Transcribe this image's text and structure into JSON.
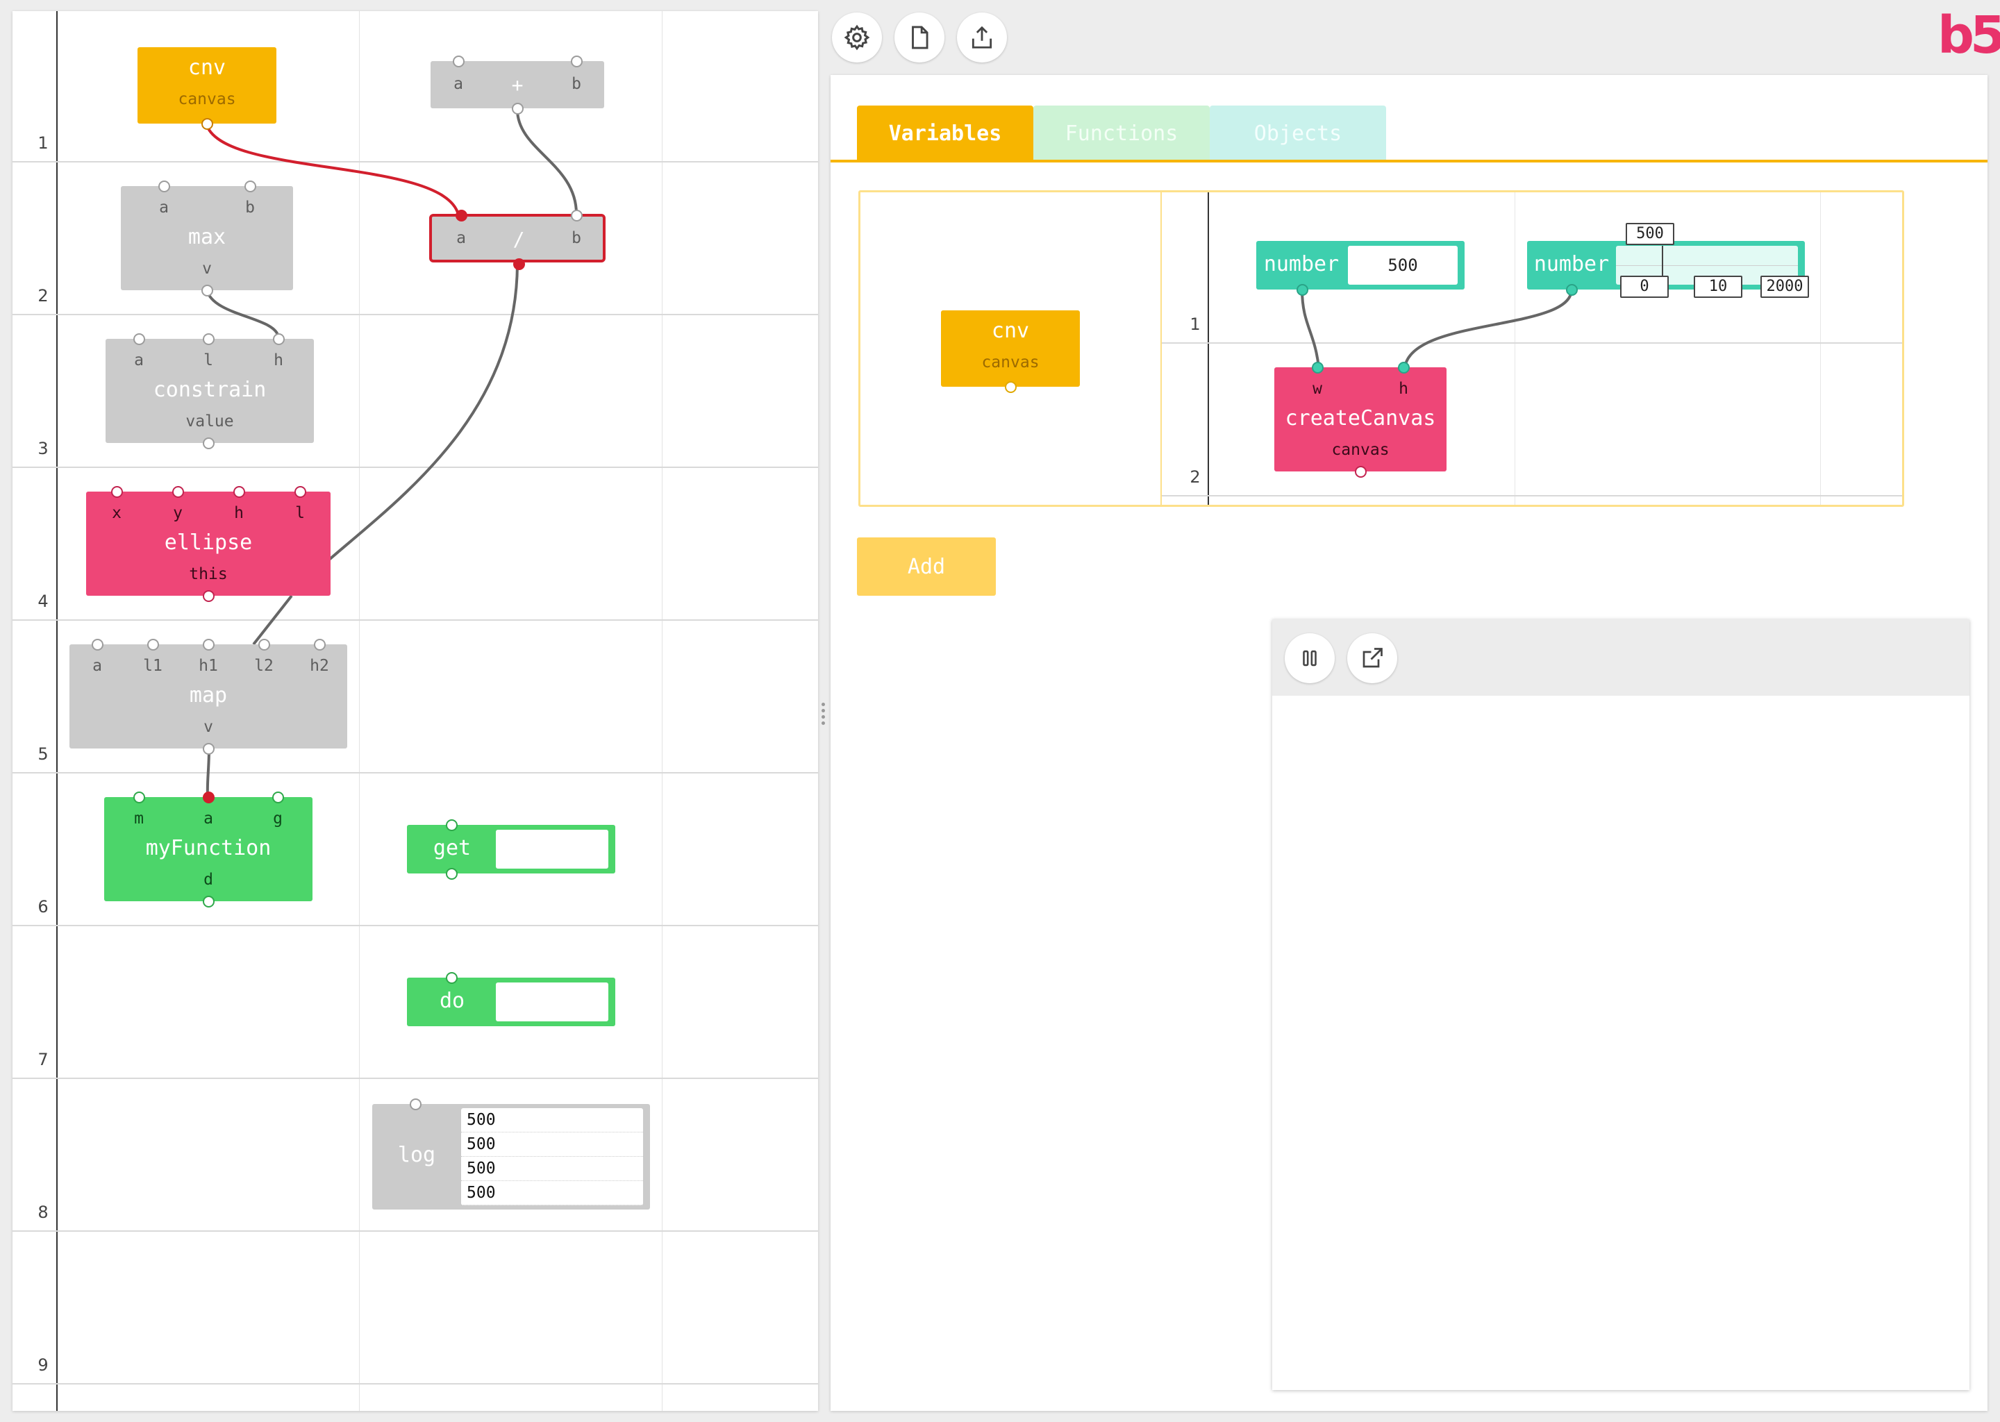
{
  "toolbar": {
    "settings_icon": "gear-icon",
    "new_file_icon": "file-icon",
    "share_icon": "export-icon"
  },
  "brand": {
    "logo_text": "b5",
    "color": "#e8336b"
  },
  "left_canvas": {
    "row_numbers": [
      "1",
      "2",
      "3",
      "4",
      "5",
      "6",
      "7",
      "8",
      "9"
    ],
    "blocks": {
      "cnv": {
        "name": "cnv",
        "sub": "canvas"
      },
      "plus": {
        "a": "a",
        "op": "+",
        "b": "b"
      },
      "divide": {
        "a": "a",
        "op": "/",
        "b": "b"
      },
      "max": {
        "a": "a",
        "b": "b",
        "name": "max",
        "out": "v"
      },
      "constrain": {
        "a": "a",
        "l": "l",
        "h": "h",
        "name": "constrain",
        "out": "value"
      },
      "ellipse": {
        "x": "x",
        "y": "y",
        "h": "h",
        "l": "l",
        "name": "ellipse",
        "out": "this"
      },
      "map": {
        "a": "a",
        "l1": "l1",
        "h1": "h1",
        "l2": "l2",
        "h2": "h2",
        "name": "map",
        "out": "v"
      },
      "myFunction": {
        "m": "m",
        "a": "a",
        "g": "g",
        "name": "myFunction",
        "out": "d"
      },
      "get": {
        "name": "get",
        "value": ""
      },
      "do": {
        "name": "do",
        "value": ""
      },
      "log": {
        "name": "log",
        "lines": [
          "500",
          "500",
          "500",
          "500"
        ]
      }
    }
  },
  "right_panel": {
    "tabs": [
      {
        "label": "Variables",
        "active": true
      },
      {
        "label": "Functions",
        "active": false
      },
      {
        "label": "Objects",
        "active": false
      }
    ],
    "variables": {
      "cnv": {
        "name": "cnv",
        "sub": "canvas"
      },
      "row_numbers": [
        "1",
        "2"
      ],
      "number1": {
        "name": "number",
        "value": "500"
      },
      "number2": {
        "name": "number",
        "value": "500",
        "min": "0",
        "step": "10",
        "max": "2000"
      },
      "createCanvas": {
        "w": "w",
        "h": "h",
        "name": "createCanvas",
        "out": "canvas"
      }
    },
    "add_button": "Add",
    "preview": {
      "pause_icon": "pause-icon",
      "open_external_icon": "external-link-icon"
    }
  },
  "colors": {
    "orange": "#f7b500",
    "pink": "#ee4677",
    "green": "#4cd56a",
    "teal": "#3ecfae",
    "gray": "#cbcbcb",
    "wire_red": "#d21f2d"
  }
}
